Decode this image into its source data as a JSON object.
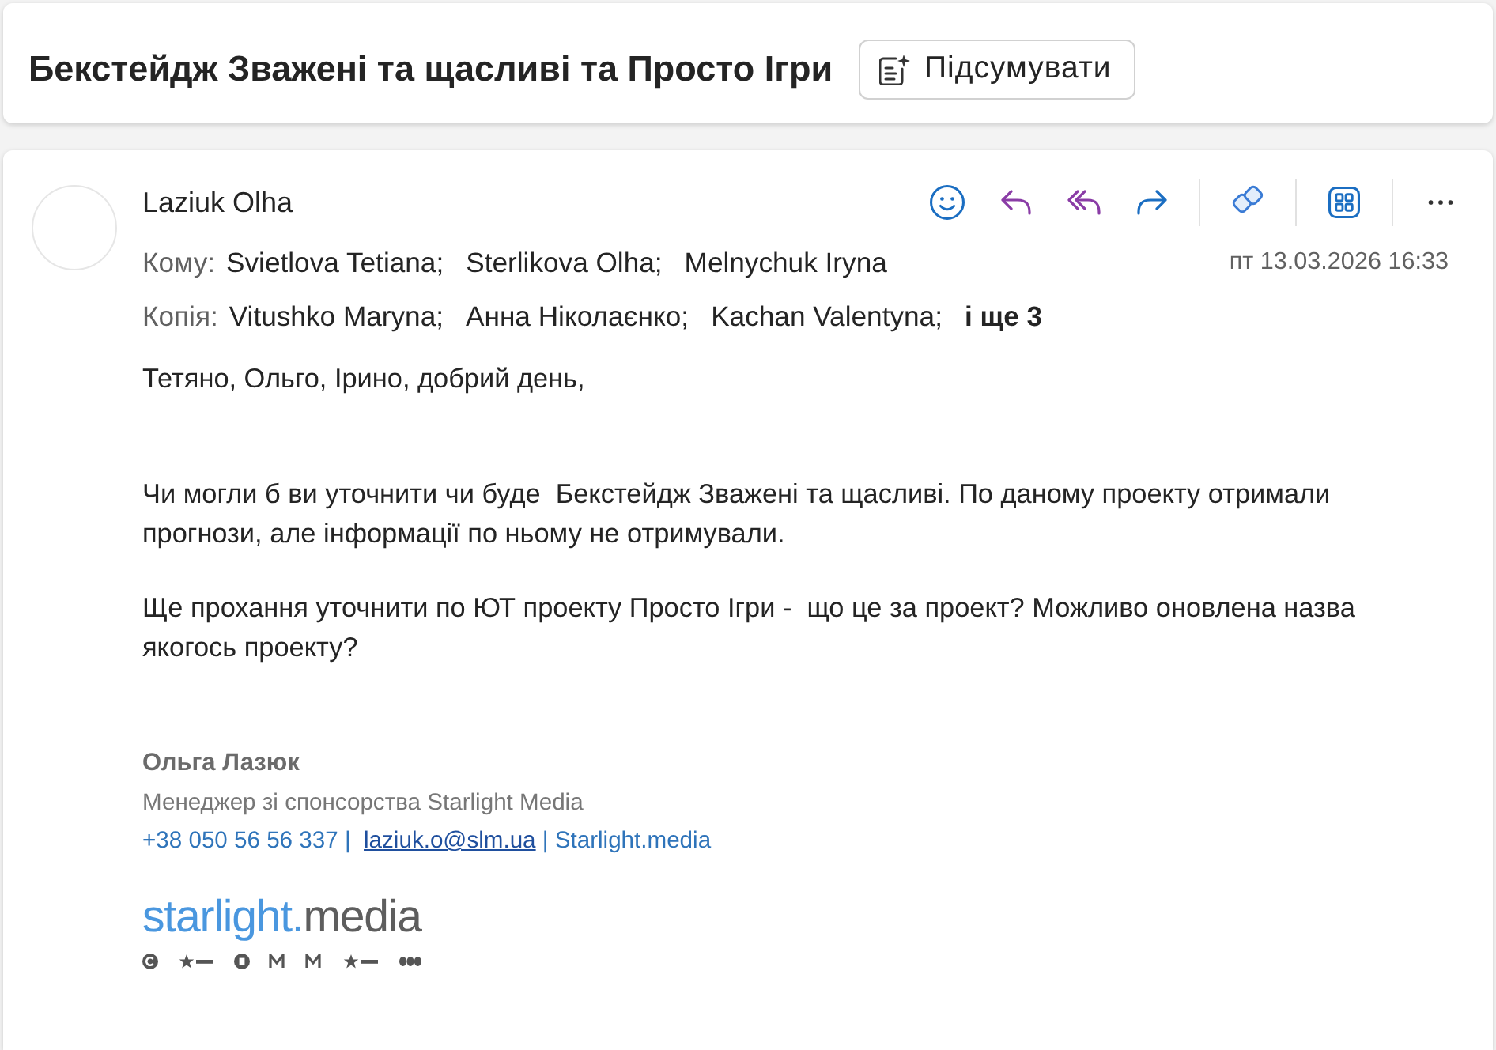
{
  "subject": {
    "title": "Бекстейдж Зважені та щасливі та Просто Ігри",
    "summarize_button": "Підсумувати"
  },
  "message": {
    "sender": "Laziuk Olha",
    "actions": [
      {
        "kind": "emoji"
      },
      {
        "kind": "reply"
      },
      {
        "kind": "reply_all"
      },
      {
        "kind": "forward"
      },
      {
        "kind": "separator"
      },
      {
        "kind": "loop"
      },
      {
        "kind": "separator"
      },
      {
        "kind": "apps"
      },
      {
        "kind": "separator"
      },
      {
        "kind": "more"
      }
    ],
    "to_label": "Кому:",
    "to": [
      "Svietlova Tetiana;",
      "Sterlikova Olha;",
      "Melnychuk Iryna"
    ],
    "date": "пт 13.03.2026 16:33",
    "cc_label": "Копія:",
    "cc": [
      "Vitushko Maryna;",
      "Анна Ніколаєнко;",
      "Kachan Valentyna;"
    ],
    "cc_more": "і ще 3",
    "body": [
      "Тетяно, Ольго, Ірино, добрий день,",
      "Чи могли б ви уточнити чи буде  Бекстейдж Зважені та щасливі. По даному проекту отримали прогнози, але інформації по ньому не отримували.",
      "Ще прохання уточнити по ЮТ проекту Просто Ігри -  що це за проект? Можливо оновлена назва якогось проекту?"
    ],
    "signature": {
      "name": "Ольга Лазюк",
      "role": "Менеджер зі спонсорства Starlight Media",
      "contacts": [
        {
          "kind": "text",
          "text": "+38 050 56 56 337 |  "
        },
        {
          "kind": "link",
          "text": "laziuk.o@slm.ua"
        },
        {
          "kind": "text",
          "text": " | Starlight.media"
        }
      ],
      "logo": {
        "brand": "starlight.",
        "suffix": "media"
      }
    }
  }
}
